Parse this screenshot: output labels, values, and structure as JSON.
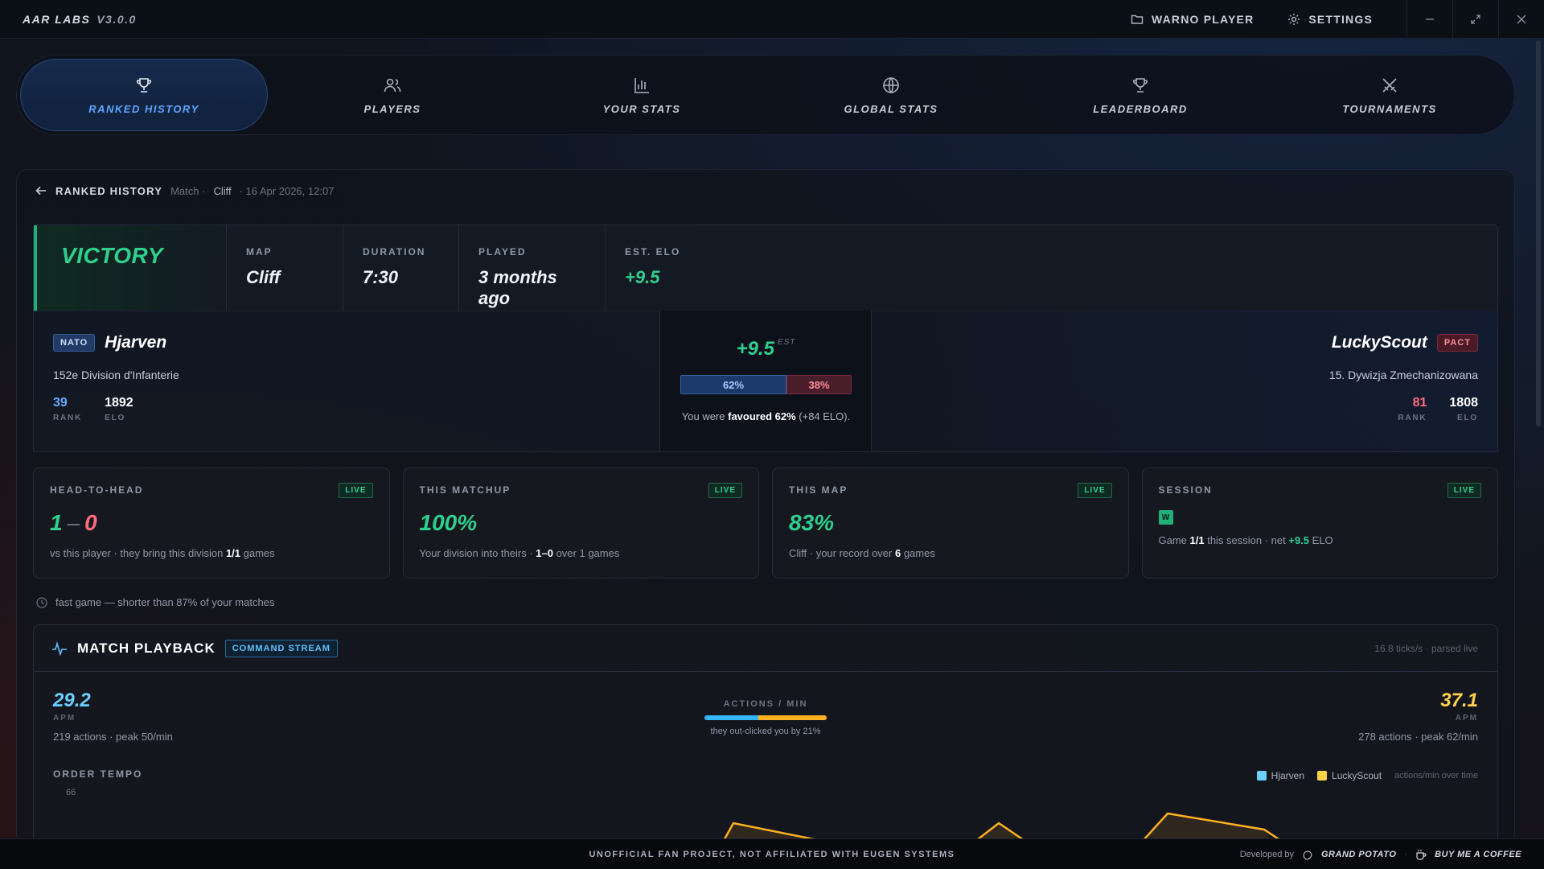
{
  "app": {
    "name": "AAR LABS",
    "version": "V3.0.0"
  },
  "titlebar": {
    "player_button": "WARNO PLAYER",
    "settings_button": "SETTINGS"
  },
  "nav": {
    "items": [
      {
        "label": "RANKED HISTORY",
        "icon": "trophy-icon",
        "active": true
      },
      {
        "label": "PLAYERS",
        "icon": "users-icon"
      },
      {
        "label": "YOUR STATS",
        "icon": "bar-chart-icon"
      },
      {
        "label": "GLOBAL STATS",
        "icon": "globe-icon"
      },
      {
        "label": "LEADERBOARD",
        "icon": "trophy-icon"
      },
      {
        "label": "TOURNAMENTS",
        "icon": "swords-icon"
      }
    ]
  },
  "breadcrumb": {
    "main": "RANKED HISTORY",
    "type": "Match ·",
    "map": "Cliff",
    "date": "· 16 Apr 2026, 12:07"
  },
  "result": {
    "outcome": "VICTORY",
    "map_label": "MAP",
    "map": "Cliff",
    "duration_label": "DURATION",
    "duration": "7:30",
    "played_label": "PLAYED",
    "played": "3 months ago",
    "elo_label": "EST. ELO",
    "elo": "+9.5"
  },
  "player_left": {
    "faction": "NATO",
    "name": "Hjarven",
    "division": "152e Division d'Infanterie",
    "rank": "39",
    "rank_label": "RANK",
    "elo": "1892",
    "elo_label": "ELO"
  },
  "player_right": {
    "faction": "PACT",
    "name": "LuckyScout",
    "division": "15. Dywizja Zmechanizowana",
    "rank": "81",
    "rank_label": "RANK",
    "elo": "1808",
    "elo_label": "ELO"
  },
  "prediction": {
    "elo_change": "+9.5",
    "est": "EST",
    "left_pct": "62%",
    "right_pct": "38%",
    "left_fraction": 0.62,
    "note_pre": "You were ",
    "note_bold": "favoured 62%",
    "note_post": " (+84 ELO)."
  },
  "cards": {
    "h2h": {
      "title": "HEAD-TO-HEAD",
      "badge": "LIVE",
      "wins": "1",
      "sep": "–",
      "losses": "0",
      "sub_pre": "vs this player · they bring this division ",
      "sub_bold": "1/1",
      "sub_post": " games"
    },
    "matchup": {
      "title": "THIS MATCHUP",
      "badge": "LIVE",
      "value": "100%",
      "sub_pre": "Your division into theirs · ",
      "sub_bold": "1–0",
      "sub_post": " over 1 games"
    },
    "map": {
      "title": "THIS MAP",
      "badge": "LIVE",
      "value": "83%",
      "sub_pre": "Cliff · your record over ",
      "sub_bold": "6",
      "sub_post": " games"
    },
    "session": {
      "title": "SESSION",
      "badge": "LIVE",
      "result_badge": "W",
      "sub_pre": "Game ",
      "sub_bold": "1/1",
      "sub_mid": " this session · net ",
      "sub_elo": "+9.5",
      "sub_post": " ELO"
    }
  },
  "fast_game": "fast game — shorter than 87% of your matches",
  "playback": {
    "title": "MATCH PLAYBACK",
    "badge": "COMMAND STREAM",
    "rate": "16.8 ticks/s · parsed live",
    "left_apm": "29.2",
    "left_label": "APM",
    "left_sub": "219 actions · peak 50/min",
    "right_apm": "37.1",
    "right_label": "APM",
    "right_sub": "278 actions · peak 62/min",
    "mid_title": "ACTIONS / MIN",
    "mid_sub": "they out-clicked you by 21%",
    "left_share": 0.44,
    "tempo_title": "ORDER TEMPO",
    "tempo_max": "66",
    "legend_left": "Hjarven",
    "legend_right": "LuckyScout",
    "legend_note": "actions/min over time",
    "color_left": "#6ad0ff",
    "color_right": "#ffb020"
  },
  "footer": {
    "center": "UNOFFICIAL FAN PROJECT, NOT AFFILIATED WITH EUGEN SYSTEMS",
    "dev_pre": "Developed by",
    "dev_name": "GRAND POTATO",
    "coffee": "BUY ME A COFFEE"
  }
}
